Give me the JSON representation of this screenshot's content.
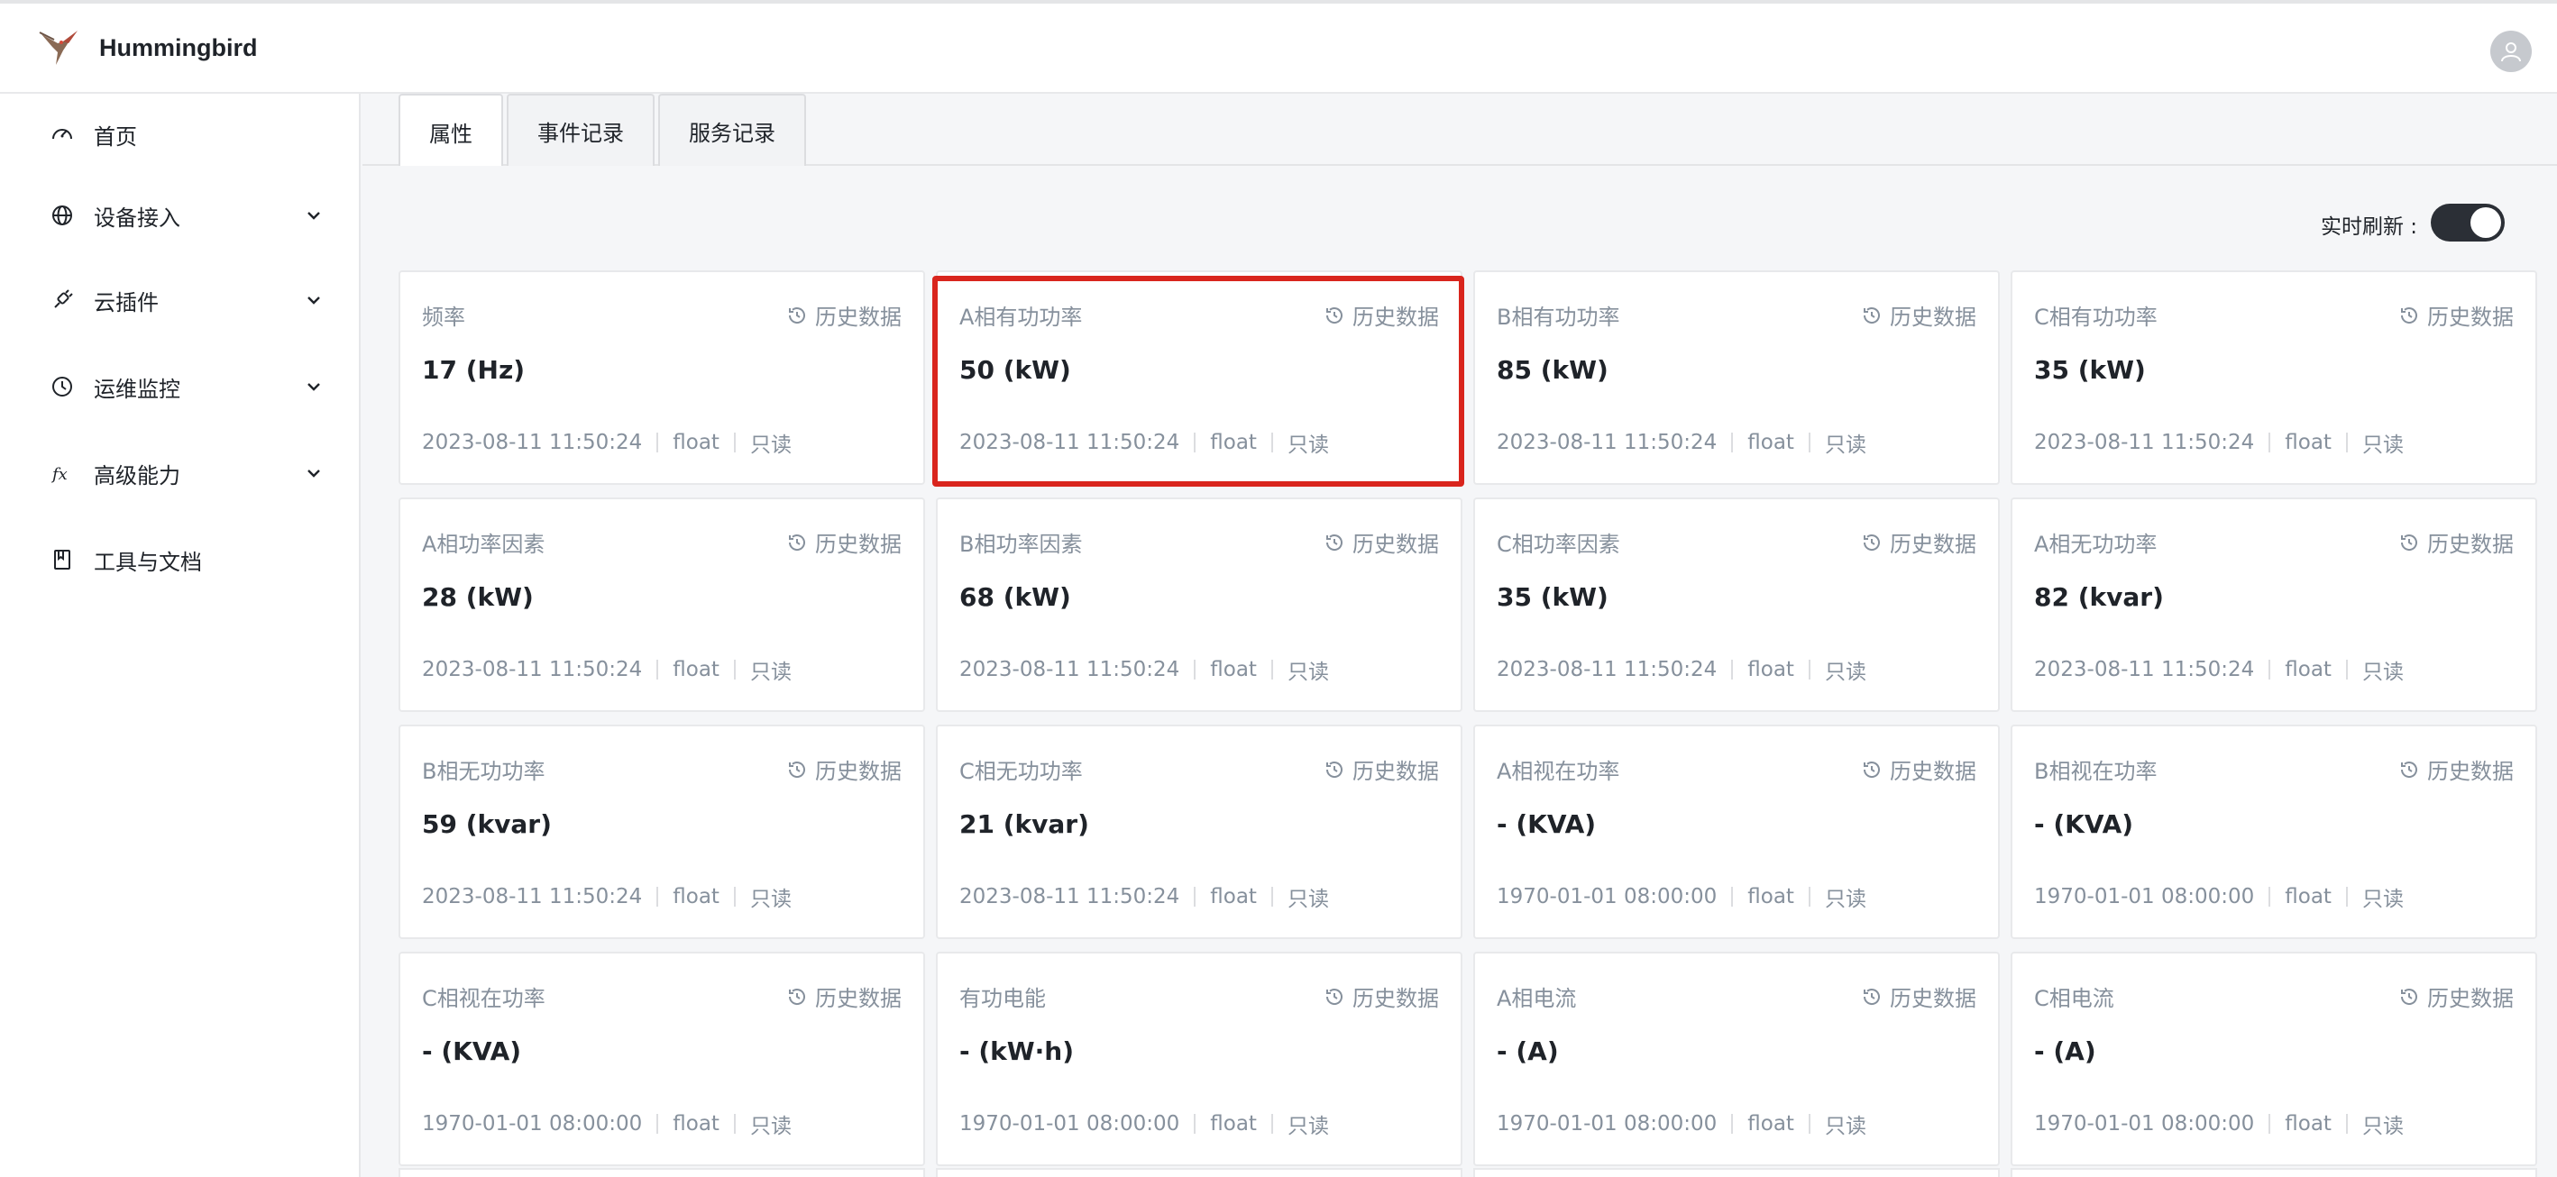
{
  "app": {
    "title": "Hummingbird"
  },
  "sidebar": {
    "items": [
      {
        "label": "首页",
        "icon": "dashboard-icon",
        "has_children": false
      },
      {
        "label": "设备接入",
        "icon": "globe-icon",
        "has_children": true
      },
      {
        "label": "云插件",
        "icon": "plugin-icon",
        "has_children": true
      },
      {
        "label": "运维监控",
        "icon": "clock-icon",
        "has_children": true
      },
      {
        "label": "高级能力",
        "icon": "function-icon",
        "has_children": true
      },
      {
        "label": "工具与文档",
        "icon": "book-icon",
        "has_children": false
      }
    ]
  },
  "tabs": [
    {
      "label": "属性",
      "active": true
    },
    {
      "label": "事件记录",
      "active": false
    },
    {
      "label": "服务记录",
      "active": false
    }
  ],
  "refresh": {
    "label": "实时刷新 :",
    "enabled": true
  },
  "history_label": "历史数据",
  "highlight_color": "#d9251d",
  "cards": [
    {
      "name": "频率",
      "value": "17 (Hz)",
      "time": "2023-08-11 11:50:24",
      "type": "float",
      "access": "只读"
    },
    {
      "name": "A相有功功率",
      "value": "50 (kW)",
      "time": "2023-08-11 11:50:24",
      "type": "float",
      "access": "只读",
      "highlighted": true
    },
    {
      "name": "B相有功功率",
      "value": "85 (kW)",
      "time": "2023-08-11 11:50:24",
      "type": "float",
      "access": "只读"
    },
    {
      "name": "C相有功功率",
      "value": "35 (kW)",
      "time": "2023-08-11 11:50:24",
      "type": "float",
      "access": "只读"
    },
    {
      "name": "A相功率因素",
      "value": "28 (kW)",
      "time": "2023-08-11 11:50:24",
      "type": "float",
      "access": "只读"
    },
    {
      "name": "B相功率因素",
      "value": "68 (kW)",
      "time": "2023-08-11 11:50:24",
      "type": "float",
      "access": "只读"
    },
    {
      "name": "C相功率因素",
      "value": "35 (kW)",
      "time": "2023-08-11 11:50:24",
      "type": "float",
      "access": "只读"
    },
    {
      "name": "A相无功功率",
      "value": "82 (kvar)",
      "time": "2023-08-11 11:50:24",
      "type": "float",
      "access": "只读"
    },
    {
      "name": "B相无功功率",
      "value": "59 (kvar)",
      "time": "2023-08-11 11:50:24",
      "type": "float",
      "access": "只读"
    },
    {
      "name": "C相无功功率",
      "value": "21 (kvar)",
      "time": "2023-08-11 11:50:24",
      "type": "float",
      "access": "只读"
    },
    {
      "name": "A相视在功率",
      "value": "- (KVA)",
      "time": "1970-01-01 08:00:00",
      "type": "float",
      "access": "只读"
    },
    {
      "name": "B相视在功率",
      "value": "- (KVA)",
      "time": "1970-01-01 08:00:00",
      "type": "float",
      "access": "只读"
    },
    {
      "name": "C相视在功率",
      "value": "- (KVA)",
      "time": "1970-01-01 08:00:00",
      "type": "float",
      "access": "只读"
    },
    {
      "name": "有功电能",
      "value": "- (kW·h)",
      "time": "1970-01-01 08:00:00",
      "type": "float",
      "access": "只读"
    },
    {
      "name": "A相电流",
      "value": "- (A)",
      "time": "1970-01-01 08:00:00",
      "type": "float",
      "access": "只读"
    },
    {
      "name": "C相电流",
      "value": "- (A)",
      "time": "1970-01-01 08:00:00",
      "type": "float",
      "access": "只读"
    }
  ]
}
